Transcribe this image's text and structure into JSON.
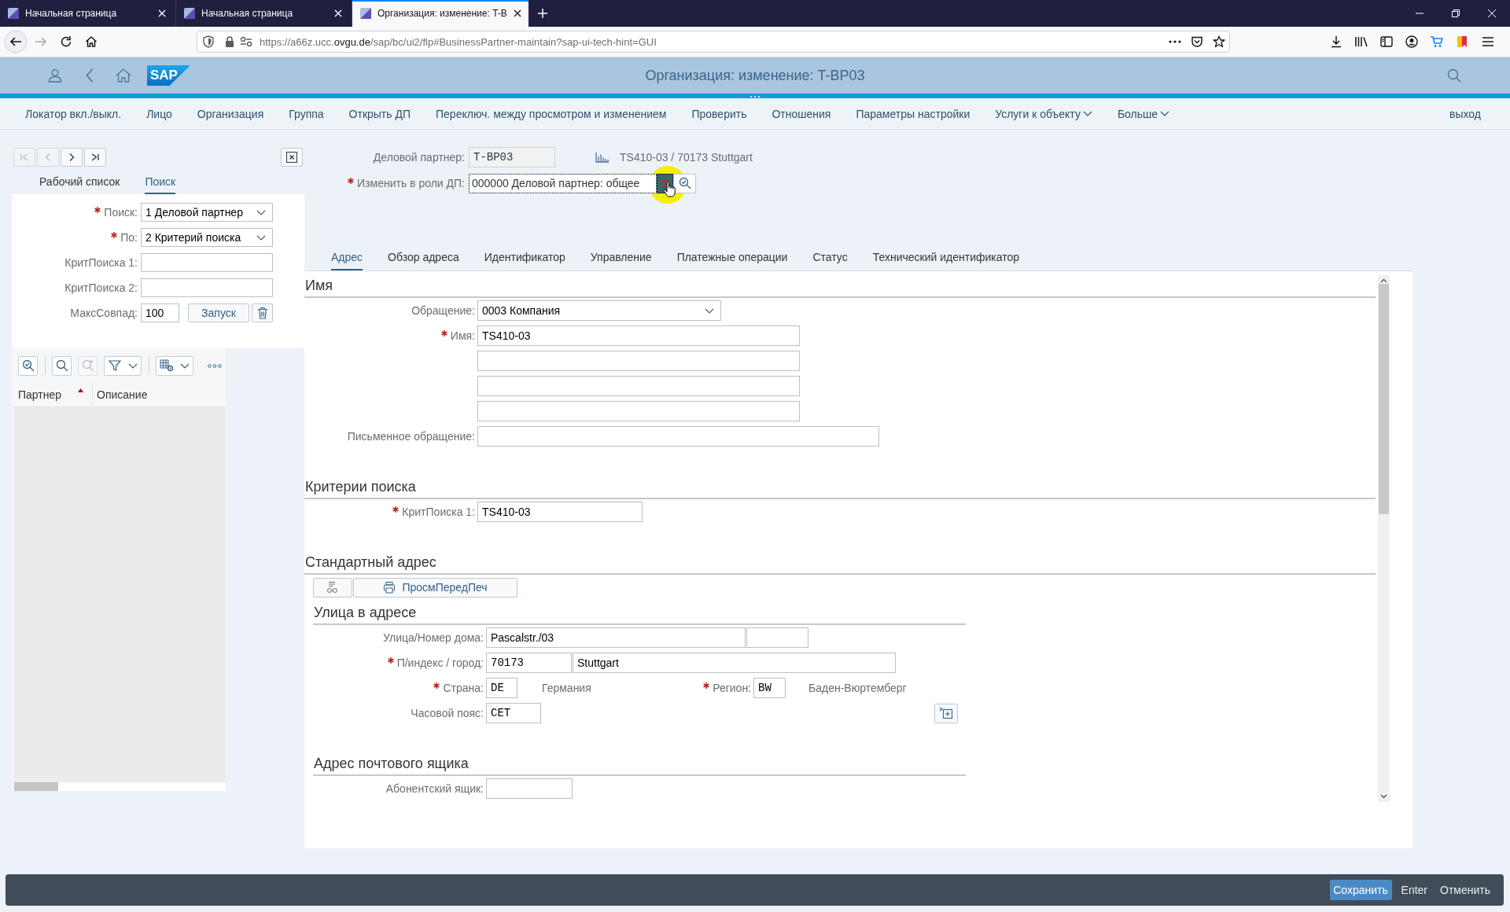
{
  "browser": {
    "tabs": [
      {
        "title": "Начальная страница",
        "selected": false
      },
      {
        "title": "Начальная страница",
        "selected": false
      },
      {
        "title": "Организация: изменение: T-B",
        "selected": true
      }
    ],
    "url": {
      "start": "https://a66z.ucc.",
      "domain": "ovgu.de",
      "rest": "/sap/bc/ui2/flp#BusinessPartner-maintain?sap-ui-tech-hint=GUI"
    }
  },
  "shell": {
    "logo": "SAP",
    "title": "Организация: изменение: T-BP03"
  },
  "menu": {
    "items": [
      {
        "label": "Локатор вкл./выкл.",
        "dropdown": false
      },
      {
        "label": "Лицо",
        "dropdown": false
      },
      {
        "label": "Организация",
        "dropdown": false
      },
      {
        "label": "Группа",
        "dropdown": false
      },
      {
        "label": "Открыть ДП",
        "dropdown": false
      },
      {
        "label": "Переключ. между просмотром и изменением",
        "dropdown": false
      },
      {
        "label": "Проверить",
        "dropdown": false
      },
      {
        "label": "Отношения",
        "dropdown": false
      },
      {
        "label": "Параметры настройки",
        "dropdown": false
      },
      {
        "label": "Услуги к объекту",
        "dropdown": true
      },
      {
        "label": "Больше",
        "dropdown": true
      }
    ],
    "exit": "выход"
  },
  "search_panel": {
    "nav": [
      {
        "disabled": true
      },
      {
        "disabled": true
      },
      {
        "disabled": false
      },
      {
        "disabled": false
      }
    ],
    "tabs": [
      {
        "label": "Рабочий список",
        "selected": false
      },
      {
        "label": "Поиск",
        "selected": true
      }
    ],
    "fields": [
      {
        "label": "Поиск:",
        "required": true,
        "kind": "select",
        "value": "1 Деловой партнер"
      },
      {
        "label": "По:",
        "required": true,
        "kind": "select",
        "value": "2 Критерий поиска"
      },
      {
        "label": "КритПоиска 1:",
        "required": false,
        "kind": "input"
      },
      {
        "label": "КритПоиска 2:",
        "required": false,
        "kind": "input"
      },
      {
        "label": "МаксСовпад:",
        "required": false,
        "kind": "input",
        "value": "100",
        "button": "Запуск"
      }
    ],
    "toolbar": [
      {
        "disabled": false
      },
      {
        "disabled": false
      },
      {
        "disabled": true
      },
      {
        "disabled": false
      },
      {
        "disabled": false
      }
    ],
    "columns": [
      {
        "label": "Партнер",
        "sorted": true
      },
      {
        "label": "Описание",
        "sorted": false
      }
    ]
  },
  "header": {
    "partner": {
      "label": "Деловой партнер:",
      "value": "T-BP03",
      "summary": "TS410-03 / 70173 Stuttgart"
    },
    "role": {
      "label": "Изменить в роли ДП:",
      "required": true,
      "value": "000000 Деловой партнер: общее",
      "focused": true,
      "cursor_highlight": true
    }
  },
  "tabs": [
    {
      "label": "Адрес",
      "selected": true
    },
    {
      "label": "Обзор адреса",
      "selected": false
    },
    {
      "label": "Идентификатор",
      "selected": false
    },
    {
      "label": "Управление",
      "selected": false
    },
    {
      "label": "Платежные операции",
      "selected": false
    },
    {
      "label": "Статус",
      "selected": false
    },
    {
      "label": "Технический идентификатор",
      "selected": false
    }
  ],
  "form_sections": [
    {
      "title": "Имя",
      "rows": [
        {
          "label": "Обращение:",
          "required": false,
          "items": [
            {
              "kind": "select",
              "value": "0003 Компания"
            }
          ]
        },
        {
          "label": "Имя:",
          "required": true,
          "items": [
            {
              "kind": "input",
              "value": "TS410-03"
            }
          ]
        },
        {
          "required": false,
          "items": [
            {
              "kind": "input"
            }
          ]
        },
        {
          "required": false,
          "items": [
            {
              "kind": "input"
            }
          ]
        },
        {
          "required": false,
          "items": [
            {
              "kind": "input"
            }
          ]
        },
        {
          "label": "Письменное обращение:",
          "required": false,
          "items": [
            {
              "kind": "input"
            }
          ]
        }
      ]
    },
    {
      "title": "Критерии поиска",
      "rows": [
        {
          "label": "КритПоиска 1:",
          "required": true,
          "items": [
            {
              "kind": "input",
              "value": "TS410-03"
            }
          ]
        }
      ]
    },
    {
      "title": "Стандартный адрес",
      "toolbar": [
        {
          "kind": "icon"
        },
        {
          "kind": "print",
          "label": "ПросмПередПеч"
        }
      ],
      "subsections": [
        {
          "title": "Улица в адресе",
          "rows": [
            {
              "label": "Улица/Номер дома:",
              "required": false,
              "items": [
                {
                  "kind": "input",
                  "value": "Pascalstr./03"
                },
                {
                  "kind": "input"
                }
              ]
            },
            {
              "label": "П/индекс / город:",
              "required": true,
              "items": [
                {
                  "kind": "code",
                  "value": "70173"
                },
                {
                  "kind": "input",
                  "value": "Stuttgart"
                }
              ]
            },
            {
              "label": "Страна:",
              "required": true,
              "items": [
                {
                  "kind": "code",
                  "value": "DE"
                },
                {
                  "kind": "text",
                  "text": "Германия"
                },
                {
                  "kind": "label",
                  "text": "Регион:",
                  "required": true
                },
                {
                  "kind": "code",
                  "value": "BW"
                },
                {
                  "kind": "text",
                  "text": "Баден-Вюртемберг"
                }
              ]
            },
            {
              "label": "Часовой пояс:",
              "required": false,
              "items": [
                {
                  "kind": "code",
                  "value": "CET"
                },
                {
                  "kind": "button"
                }
              ]
            }
          ]
        },
        {
          "title": "Адрес почтового ящика",
          "rows": [
            {
              "label": "Абонентский ящик:",
              "required": false,
              "items": [
                {
                  "kind": "input"
                }
              ]
            }
          ]
        }
      ]
    }
  ],
  "footer": {
    "buttons": [
      {
        "label": "Сохранить",
        "emphasized": true
      },
      {
        "label": "Enter",
        "emphasized": false
      },
      {
        "label": "Отменить",
        "emphasized": false
      }
    ]
  }
}
